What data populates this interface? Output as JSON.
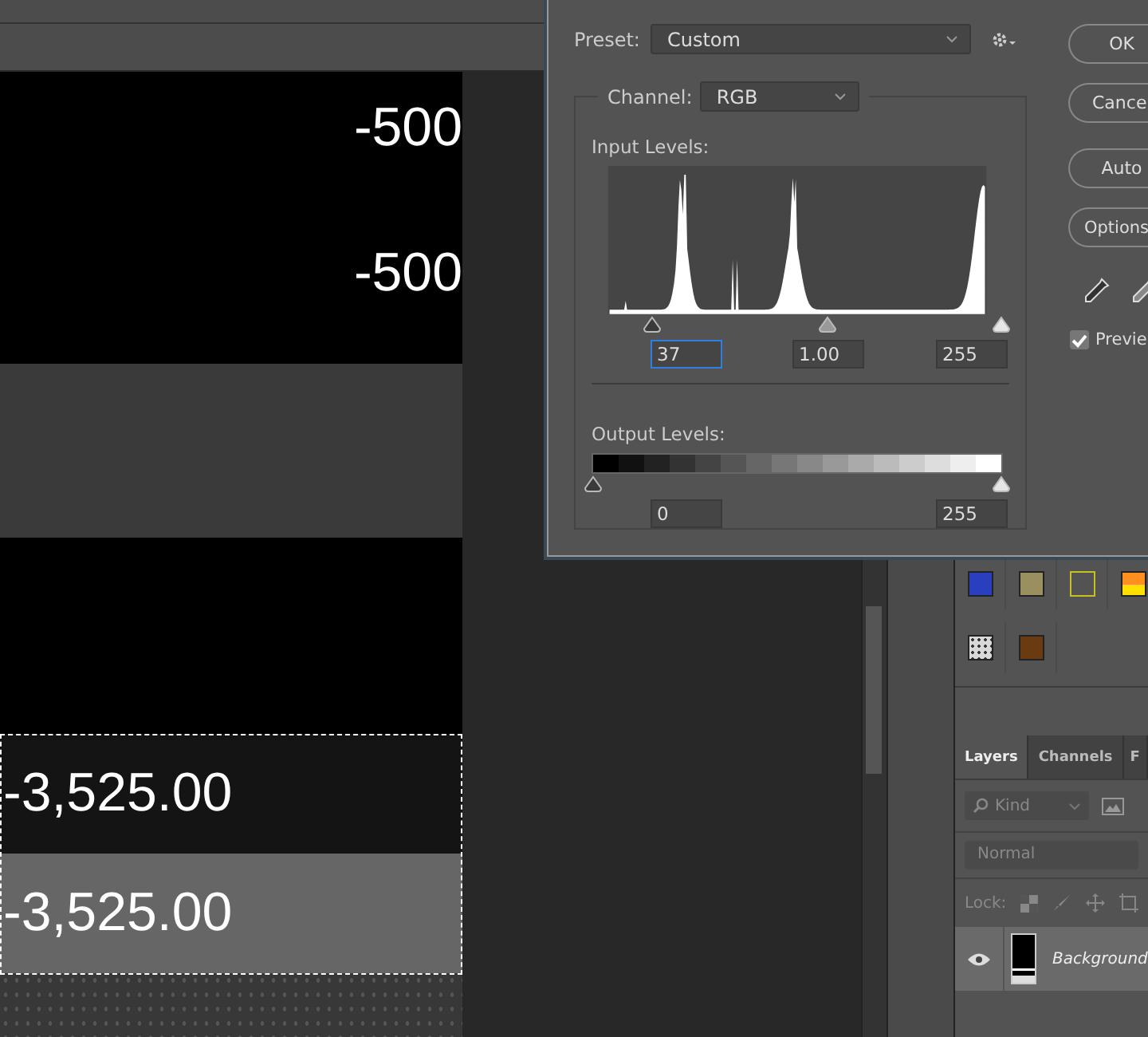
{
  "canvas": {
    "rows": [
      {
        "kind": "black",
        "value": "-500"
      },
      {
        "kind": "black",
        "value": "-500"
      },
      {
        "kind": "gray"
      },
      {
        "kind": "black"
      },
      {
        "kind": "dark",
        "value": "-3,525.00"
      },
      {
        "kind": "light",
        "value": "-3,525.00"
      },
      {
        "kind": "noise"
      }
    ]
  },
  "levels_dialog": {
    "preset_label": "Preset:",
    "preset": "Custom",
    "channel_label": "Channel:",
    "channel": "RGB",
    "input_label": "Input Levels:",
    "input_sliders": [
      {
        "level": 0.145
      },
      {
        "level": 0.573
      },
      {
        "level": 1
      }
    ],
    "input_values": [
      {
        "value": "37",
        "focused": true
      },
      {
        "value": "1.00",
        "focused": false
      },
      {
        "value": "255",
        "focused": false
      }
    ],
    "output_label": "Output Levels:",
    "output_sliders": [
      {
        "level": 0
      },
      {
        "level": 1
      }
    ],
    "output_values": [
      "0",
      "255"
    ],
    "buttons": [
      "OK",
      "Cance",
      "Auto",
      "Options"
    ],
    "preview": {
      "label": "Previe",
      "checked": true
    }
  },
  "styles": [
    {
      "kind": "fill",
      "color": "#2a3fc0"
    },
    {
      "kind": "fill",
      "color": "#9a8f5f"
    },
    {
      "kind": "outline",
      "color": "#c8c020"
    },
    {
      "kind": "gradient",
      "color": "#ff9020"
    },
    {
      "kind": "pattern",
      "color": "#d8d8d8"
    },
    {
      "kind": "fill",
      "color": "#6a3a10"
    }
  ],
  "layers_panel": {
    "tabs": [
      {
        "label": "Layers",
        "selected": true
      },
      {
        "label": "Channels",
        "selected": false
      },
      {
        "label": "F",
        "selected": false
      }
    ],
    "filter": {
      "placeholder": "Kind"
    },
    "blend_mode": "Normal",
    "lock_label": "Lock:",
    "layers": [
      {
        "name": "Background",
        "visible": true
      }
    ]
  }
}
